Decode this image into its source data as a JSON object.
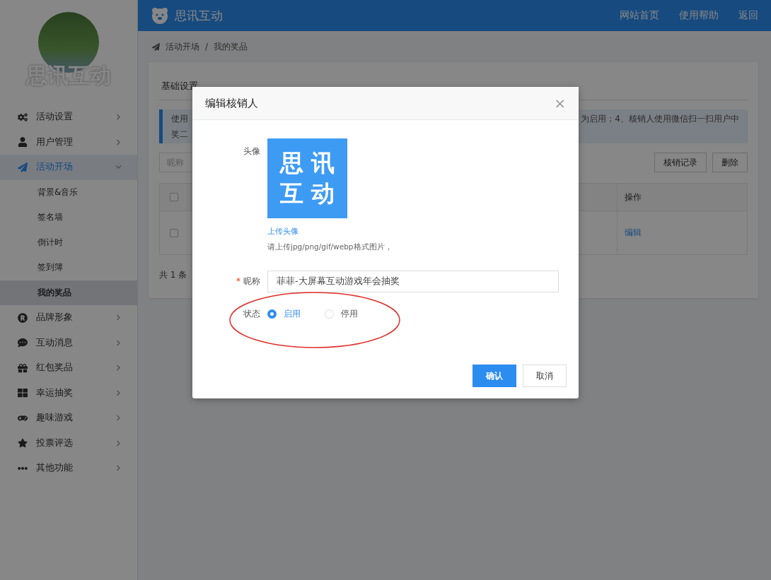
{
  "header": {
    "logo": "思讯互动",
    "nav": [
      "网站首页",
      "使用帮助",
      "返回"
    ]
  },
  "sidebar": {
    "brand": "思讯互动",
    "items": [
      {
        "label": "活动设置",
        "selected": false,
        "expanded": false
      },
      {
        "label": "用户管理",
        "selected": false,
        "expanded": false
      },
      {
        "label": "活动开场",
        "selected": true,
        "expanded": true,
        "children": [
          {
            "label": "背景&音乐",
            "selected": false
          },
          {
            "label": "签名墙",
            "selected": false
          },
          {
            "label": "倒计时",
            "selected": false
          },
          {
            "label": "签到簿",
            "selected": false
          },
          {
            "label": "我的奖品",
            "selected": true
          }
        ]
      },
      {
        "label": "品牌形象",
        "selected": false,
        "expanded": false
      },
      {
        "label": "互动消息",
        "selected": false,
        "expanded": false
      },
      {
        "label": "红包奖品",
        "selected": false,
        "expanded": false
      },
      {
        "label": "幸运抽奖",
        "selected": false,
        "expanded": false
      },
      {
        "label": "趣味游戏",
        "selected": false,
        "expanded": false
      },
      {
        "label": "投票评选",
        "selected": false,
        "expanded": false
      },
      {
        "label": "其他功能",
        "selected": false,
        "expanded": false
      }
    ]
  },
  "breadcrumb": [
    "活动开场",
    "/",
    "我的奖品"
  ],
  "tabs": [
    {
      "label": "基础设置",
      "selected": false
    }
  ],
  "notice": {
    "left_lines": [
      "使用",
      "奖二"
    ],
    "right": "为启用；4、核销人使用微信扫一扫用户中"
  },
  "toolbar": {
    "search_placeholder": "昵称",
    "buttons": [
      "核销记录",
      "删除"
    ]
  },
  "table": {
    "header_checked": false,
    "action_heading": "操作",
    "rows": [
      {
        "checked": false,
        "action": "编辑"
      }
    ]
  },
  "footer": "共 1 条",
  "dialog": {
    "title": "编辑核销人",
    "close": "×",
    "avatar_label": "头像",
    "avatar_lines": [
      "思 讯",
      "互 动"
    ],
    "upload_link": "上传头像",
    "upload_hint": "请上传jpg/png/gif/webp格式图片，",
    "nickname_label": "昵称",
    "required_mark": "*",
    "nickname_value": "菲菲-大屏幕互动游戏年会抽奖",
    "status_label": "状态",
    "status_options": [
      {
        "label": "启用",
        "selected": true
      },
      {
        "label": "停用",
        "selected": false
      }
    ],
    "buttons": [
      {
        "label": "确认",
        "kind": "primary"
      },
      {
        "label": "取消",
        "kind": "default"
      }
    ]
  }
}
